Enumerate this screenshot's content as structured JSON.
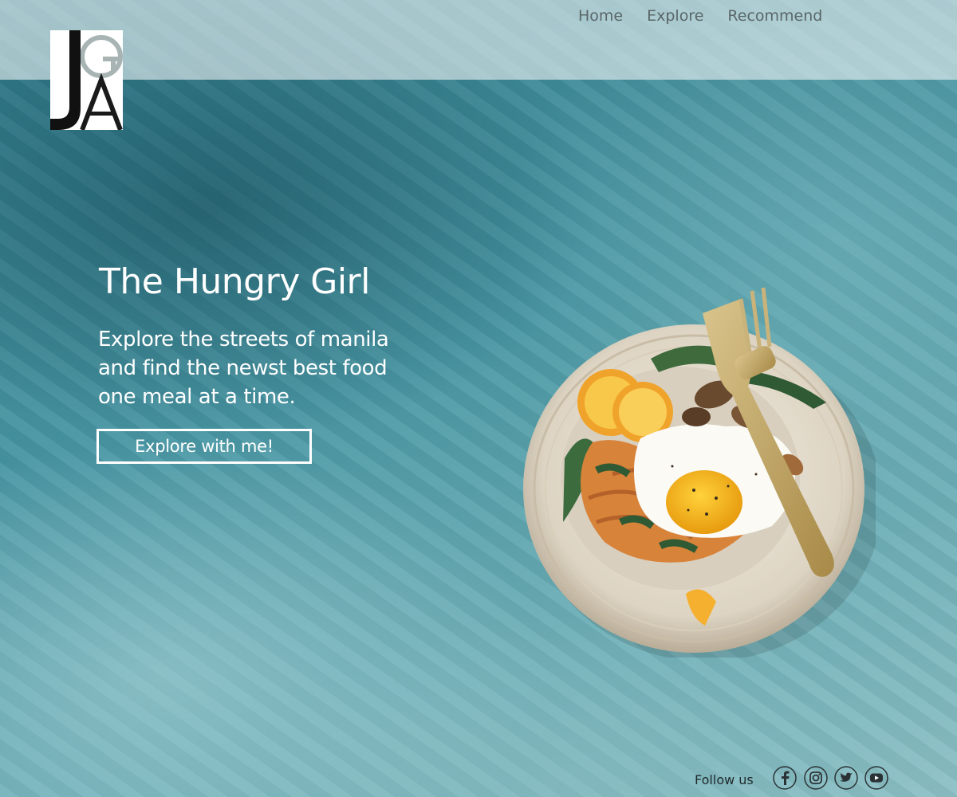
{
  "brand": {
    "logo_letters": [
      "J",
      "G",
      "A"
    ]
  },
  "nav": {
    "items": [
      "Home",
      "Explore",
      "Recommend"
    ]
  },
  "hero": {
    "title": "The Hungry Girl",
    "lines": [
      "Explore the streets of manila",
      "and find the newst best food",
      "one meal at a time."
    ],
    "cta": "Explore with me!"
  },
  "footer": {
    "follow_label": "Follow us",
    "social": [
      "facebook-icon",
      "instagram-icon",
      "twitter-icon",
      "youtube-icon"
    ]
  },
  "colors": {
    "nav_text": "#5a6667",
    "hero_text": "#ffffff",
    "background": "#4a98a5",
    "footer_text": "#1f2a2c"
  }
}
